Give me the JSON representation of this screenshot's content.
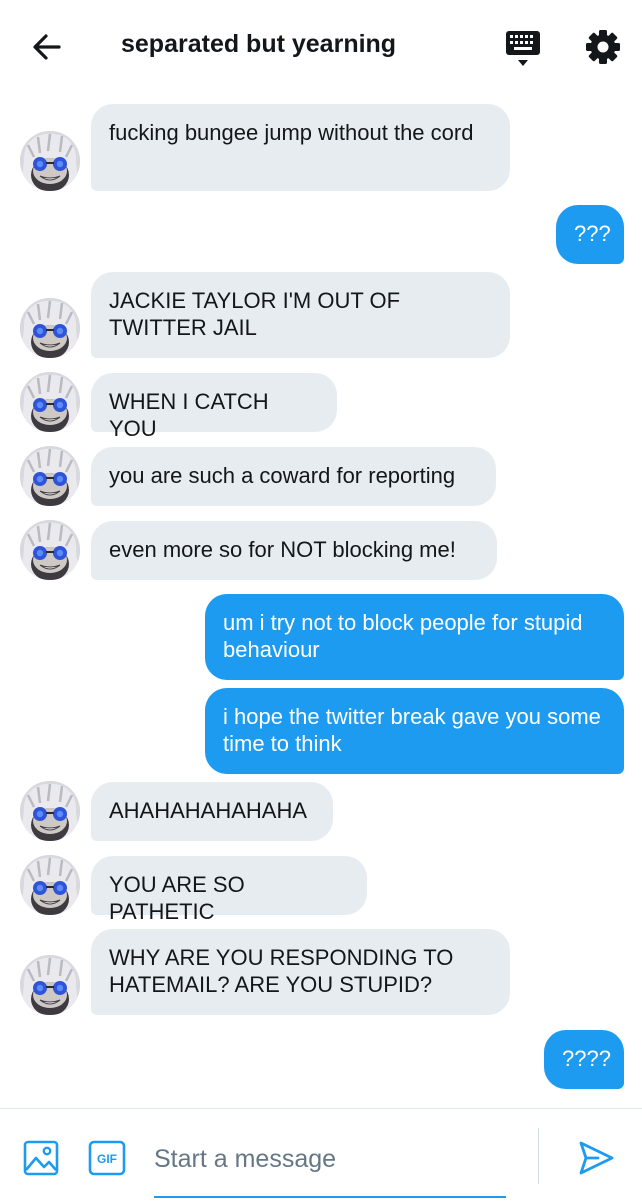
{
  "header": {
    "title": "separated but yearning",
    "back_icon": "arrow-left-icon",
    "keyboard_icon": "keyboard-icon",
    "settings_icon": "gear-icon"
  },
  "messages": [
    {
      "direction": "in",
      "text": "fucking bungee jump without the cord"
    },
    {
      "direction": "out",
      "text": "???"
    },
    {
      "direction": "in",
      "text": "JACKIE TAYLOR I'M OUT OF TWITTER JAIL"
    },
    {
      "direction": "in",
      "text": "WHEN I CATCH YOU"
    },
    {
      "direction": "in",
      "text": "you are such a coward for reporting"
    },
    {
      "direction": "in",
      "text": "even more so for NOT blocking me!"
    },
    {
      "direction": "out",
      "text": "um i try not to block people for stupid behaviour"
    },
    {
      "direction": "out",
      "text": "i hope the twitter break gave you some time to think"
    },
    {
      "direction": "in",
      "text": "AHAHAHAHAHAHA"
    },
    {
      "direction": "in",
      "text": "YOU ARE SO PATHETIC"
    },
    {
      "direction": "in",
      "text": "WHY ARE YOU RESPONDING TO HATEMAIL? ARE YOU STUPID?"
    },
    {
      "direction": "out",
      "text": "????"
    }
  ],
  "composer": {
    "placeholder": "Start a message",
    "gif_label": "GIF",
    "image_icon": "image-icon",
    "send_icon": "send-icon"
  },
  "colors": {
    "accent": "#1d9bf0",
    "incoming_bubble": "#e6ecf0",
    "text": "#14171a",
    "placeholder": "#657786"
  }
}
